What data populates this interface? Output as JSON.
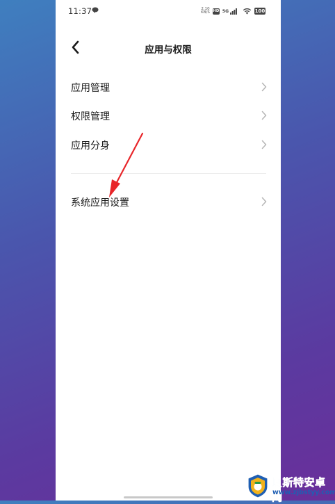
{
  "status_bar": {
    "time": "11:37",
    "speed_value": "2.10",
    "speed_unit": "KB/S",
    "hd_label": "HD",
    "network_label": "5G",
    "battery": "100"
  },
  "header": {
    "title": "应用与权限"
  },
  "menu": {
    "items": [
      {
        "label": "应用管理"
      },
      {
        "label": "权限管理"
      },
      {
        "label": "应用分身"
      },
      {
        "label": "系统应用设置"
      }
    ]
  },
  "watermark": {
    "name": "贝斯特安卓网",
    "url": "www.zjbstyy.com"
  },
  "colors": {
    "arrow": "#e8262a",
    "watermark": "#1f5fb3"
  }
}
